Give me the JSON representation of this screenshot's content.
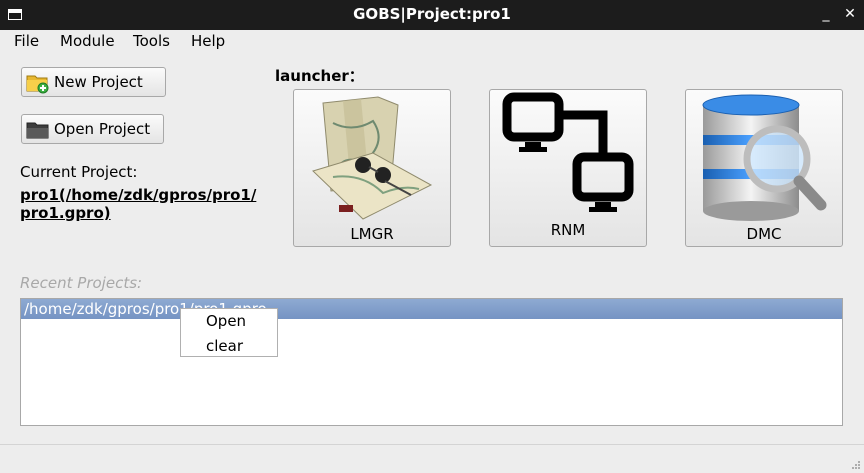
{
  "window": {
    "title": "GOBS|Project:pro1",
    "minimize": "_",
    "close": "✕"
  },
  "menu": [
    "File",
    "Module",
    "Tools",
    "Help"
  ],
  "buttons": {
    "new_project": "New Project",
    "open_project": "Open Project"
  },
  "current_project": {
    "label": "Current Project:",
    "path_line1": "pro1(/home/zdk/gpros/pro1/",
    "path_line2": "pro1.gpro)"
  },
  "launcher": {
    "label": "launcher",
    "colon": "：",
    "items": [
      {
        "label": "LMGR",
        "icon": "map-icon"
      },
      {
        "label": "RNM",
        "icon": "network-icon"
      },
      {
        "label": "DMC",
        "icon": "database-search-icon"
      }
    ]
  },
  "recent": {
    "label": "Recent Projects:",
    "items": [
      "/home/zdk/gpros/pro1/pro1.gpro"
    ]
  },
  "context_menu": [
    "Open",
    "clear"
  ]
}
